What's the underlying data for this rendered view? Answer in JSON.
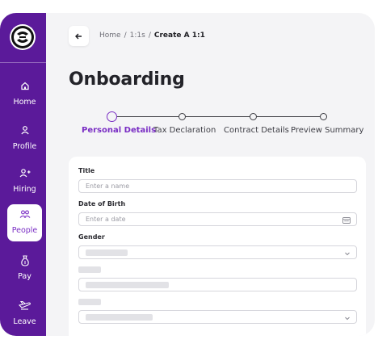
{
  "sidebar": {
    "logo_icon": "brand-logo-icon",
    "items": [
      {
        "label": "Home",
        "icon": "home-icon",
        "active": false
      },
      {
        "label": "Profile",
        "icon": "user-icon",
        "active": false
      },
      {
        "label": "Hiring",
        "icon": "user-plus-icon",
        "active": false
      },
      {
        "label": "People",
        "icon": "people-icon",
        "active": true
      },
      {
        "label": "Pay",
        "icon": "money-bag-icon",
        "active": false
      },
      {
        "label": "Leave",
        "icon": "plane-icon",
        "active": false
      }
    ]
  },
  "header": {
    "back_icon": "arrow-left-icon",
    "breadcrumb": {
      "home": "Home",
      "section": "1:1s",
      "current": "Create A 1:1",
      "separator": "/"
    }
  },
  "page": {
    "title": "Onboarding"
  },
  "stepper": {
    "steps": [
      {
        "label": "Personal Details",
        "active": true
      },
      {
        "label": "Tax Declaration",
        "active": false
      },
      {
        "label": "Contract Details",
        "active": false
      },
      {
        "label": "Preview Summary",
        "active": false
      }
    ]
  },
  "form": {
    "title": {
      "label": "Title",
      "placeholder": "Enter a name"
    },
    "dob": {
      "label": "Date of Birth",
      "placeholder": "Enter a date",
      "icon": "calendar-icon"
    },
    "gender": {
      "label": "Gender",
      "icon": "chevron-down-icon"
    }
  },
  "colors": {
    "sidebar": "#5b1a9a",
    "accent": "#7a2ec4",
    "background": "#f4f4f6"
  }
}
